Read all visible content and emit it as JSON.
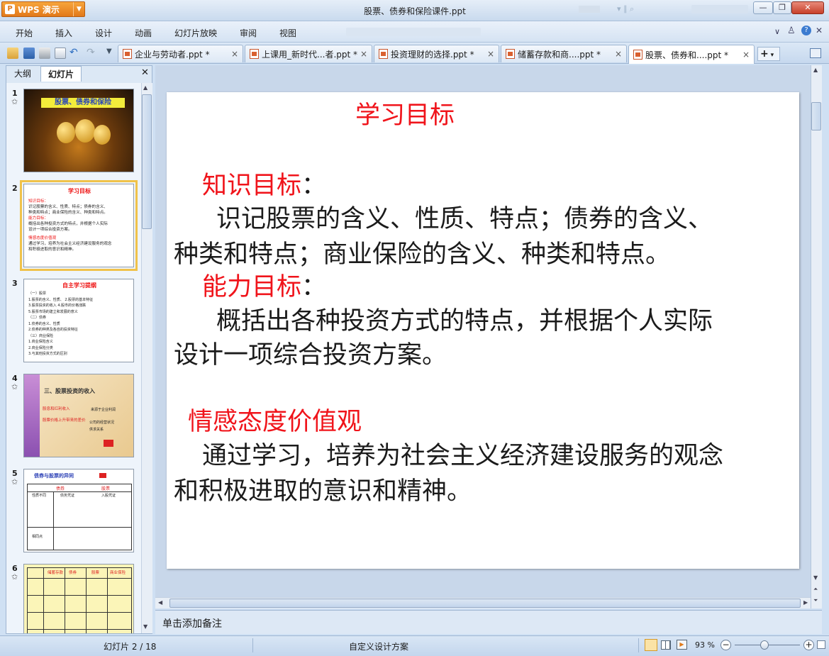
{
  "app": {
    "name": "WPS 演示",
    "doc_title": "股票、债券和保险课件.ppt"
  },
  "menu": [
    "开始",
    "插入",
    "设计",
    "动画",
    "幻灯片放映",
    "审阅",
    "视图"
  ],
  "tabs": [
    {
      "label": "企业与劳动者.ppt *"
    },
    {
      "label": "上课用_新时代...者.ppt *"
    },
    {
      "label": "投资理财的选择.ppt *"
    },
    {
      "label": "储蓄存款和商....ppt *"
    },
    {
      "label": "股票、债券和....ppt *"
    }
  ],
  "panel": {
    "outline_tab": "大纲",
    "slides_tab": "幻灯片"
  },
  "thumbs": [
    {
      "num": "1",
      "title": "股票、债券和保险"
    },
    {
      "num": "2",
      "title": "学习目标",
      "lines": [
        "知识目标：",
        "识记股票的含义、性质、特点；债券的含义、",
        "种类和特点；商业保险的含义、种类和特点。",
        "能力目标：",
        "概括出各种投资方式的特点，并根据个人实际",
        "设计一项综合投资方案。",
        "情感态度价值观",
        "通过学习，培养为社会主义经济建设服务的观念",
        "和积极进取的意识和精神。"
      ]
    },
    {
      "num": "3",
      "title": "自主学习提纲",
      "lines": [
        "（一）股票",
        "1.股票的含义、性质、 2.股票的基本特征",
        "3.股票投资的收入 4.股市的价格涨跌",
        "5.股票市场的建立和发展的意义",
        "（二）债券",
        "1.债券的含义、性质",
        "2.债券的种类及各自的投资特征",
        "（三）商业保险",
        "1.商业保险含义",
        "2.商业保险分类",
        "3.与其他投资方式的区别"
      ]
    },
    {
      "num": "4",
      "title": "三、股票投资的收入",
      "lines": [
        "股息和红利收入",
        "股票价格上升带来的差价",
        "来源于企业利润",
        "公司的经营状况",
        "供求关系"
      ]
    },
    {
      "num": "5",
      "title": "债券与股票的异同",
      "lines": [
        "债券",
        "股票",
        "性质不同",
        "债务凭证",
        "入股凭证",
        "相同点"
      ]
    },
    {
      "num": "6",
      "lines": [
        "储蓄存款",
        "债券",
        "股票",
        "商业保险"
      ]
    }
  ],
  "slide": {
    "title": "学习目标",
    "knowledge_head": "知识目标",
    "colon": "：",
    "knowledge_line1": "识记股票的含义、性质、特点；债券的含义、",
    "knowledge_line2": "种类和特点；商业保险的含义、种类和特点。",
    "ability_head": "能力目标",
    "ability_line1": "概括出各种投资方式的特点，并根据个人实际",
    "ability_line2": "设计一项综合投资方案。",
    "emotion_head": "情感态度价值观",
    "emotion_line1": "通过学习，培养为社会主义经济建设服务的观念",
    "emotion_line2": "和积极进取的意识和精神。"
  },
  "notes": {
    "placeholder": "单击添加备注"
  },
  "status": {
    "slide_pos": "幻灯片 2 / 18",
    "design": "自定义设计方案",
    "zoom": "93 %"
  }
}
